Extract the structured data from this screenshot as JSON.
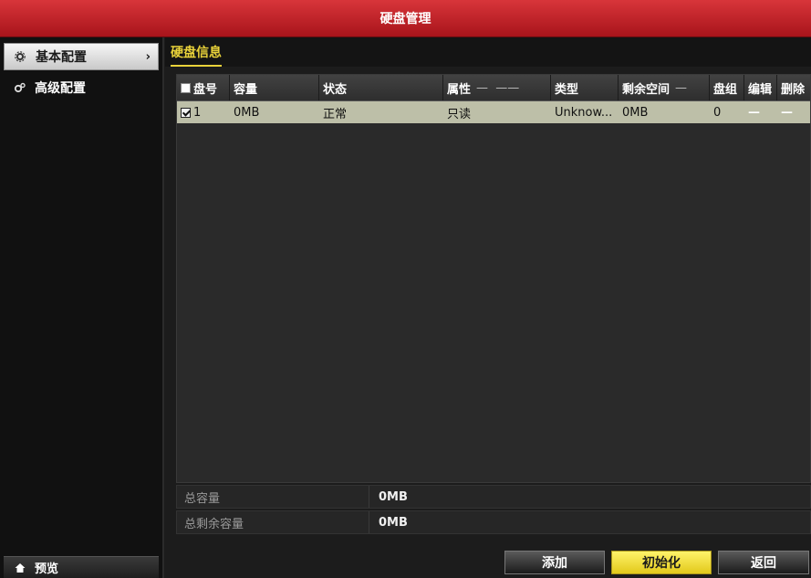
{
  "window": {
    "title": "硬盘管理"
  },
  "sidebar": {
    "items": [
      {
        "label": "基本配置",
        "icon": "gear-icon",
        "active": true
      },
      {
        "label": "高级配置",
        "icon": "gears-icon",
        "active": false
      }
    ],
    "preview": {
      "label": "预览",
      "icon": "home-icon"
    }
  },
  "tabs": [
    {
      "label": "硬盘信息"
    }
  ],
  "table": {
    "columns": [
      "盘号",
      "容量",
      "状态",
      "属性",
      "类型",
      "剩余空间",
      "盘组",
      "编辑",
      "删除"
    ],
    "rows": [
      {
        "checked": true,
        "no": "1",
        "capacity": "0MB",
        "status": "正常",
        "attribute": "只读",
        "type": "Unknow...",
        "free": "0MB",
        "group": "0",
        "edit": "—",
        "delete": "—"
      }
    ]
  },
  "summary": {
    "total_capacity_label": "总容量",
    "total_capacity_value": "0MB",
    "total_free_label": "总剩余容量",
    "total_free_value": "0MB"
  },
  "buttons": {
    "add": "添加",
    "init": "初始化",
    "back": "返回"
  },
  "colors": {
    "titlebar": "#c0222a",
    "accent_yellow": "#e9d23a",
    "selected_row": "#bdbfa8"
  }
}
